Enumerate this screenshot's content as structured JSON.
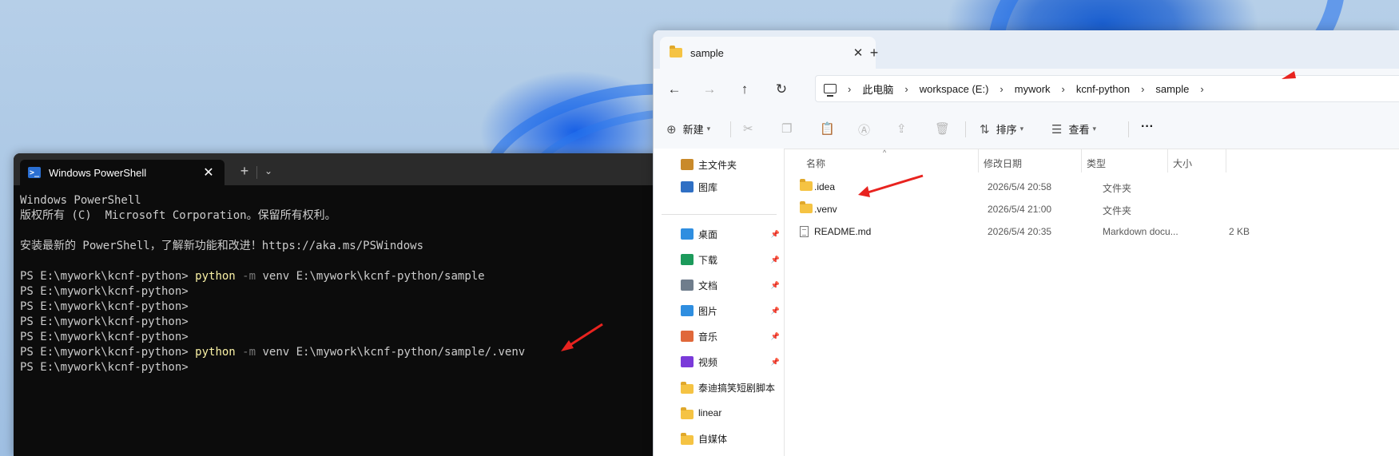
{
  "terminal": {
    "tab_title": "Windows PowerShell",
    "lines": [
      {
        "pre": "Windows PowerShell",
        "cmd": "",
        "flag": "",
        "post": ""
      },
      {
        "pre": "版权所有 (C)  Microsoft Corporation。保留所有权利。",
        "cmd": "",
        "flag": "",
        "post": ""
      },
      {
        "pre": "",
        "cmd": "",
        "flag": "",
        "post": ""
      },
      {
        "pre": "安装最新的 PowerShell，了解新功能和改进！https://aka.ms/PSWindows",
        "cmd": "",
        "flag": "",
        "post": ""
      },
      {
        "pre": "",
        "cmd": "",
        "flag": "",
        "post": ""
      },
      {
        "pre": "PS E:\\mywork\\kcnf-python> ",
        "cmd": "python",
        "flag": " -m",
        "post": " venv E:\\mywork\\kcnf-python/sample"
      },
      {
        "pre": "PS E:\\mywork\\kcnf-python>",
        "cmd": "",
        "flag": "",
        "post": ""
      },
      {
        "pre": "PS E:\\mywork\\kcnf-python>",
        "cmd": "",
        "flag": "",
        "post": ""
      },
      {
        "pre": "PS E:\\mywork\\kcnf-python>",
        "cmd": "",
        "flag": "",
        "post": ""
      },
      {
        "pre": "PS E:\\mywork\\kcnf-python>",
        "cmd": "",
        "flag": "",
        "post": ""
      },
      {
        "pre": "PS E:\\mywork\\kcnf-python> ",
        "cmd": "python",
        "flag": " -m",
        "post": " venv E:\\mywork\\kcnf-python/sample/.venv"
      },
      {
        "pre": "PS E:\\mywork\\kcnf-python>",
        "cmd": "",
        "flag": "",
        "post": ""
      }
    ]
  },
  "explorer": {
    "tab_title": "sample",
    "breadcrumb": [
      "此电脑",
      "workspace (E:)",
      "mywork",
      "kcnf-python",
      "sample"
    ],
    "toolbar": {
      "new_label": "新建",
      "sort_label": "排序",
      "view_label": "查看",
      "more_label": "···"
    },
    "sidebar": {
      "top": [
        {
          "label": "主文件夹",
          "icon": "home-icon"
        },
        {
          "label": "图库",
          "icon": "gallery-icon"
        }
      ],
      "pinned": [
        {
          "label": "桌面",
          "icon": "desktop-icon",
          "color": "#2f8ee0"
        },
        {
          "label": "下载",
          "icon": "download-icon",
          "color": "#1c9a5b"
        },
        {
          "label": "文档",
          "icon": "document-icon",
          "color": "#6f7d8c"
        },
        {
          "label": "图片",
          "icon": "picture-icon",
          "color": "#2f8ee0"
        },
        {
          "label": "音乐",
          "icon": "music-icon",
          "color": "#e0683a"
        },
        {
          "label": "视频",
          "icon": "video-icon",
          "color": "#7a3ad9"
        }
      ],
      "folders": [
        {
          "label": "泰迪搞笑短剧脚本"
        },
        {
          "label": "linear"
        },
        {
          "label": "自媒体"
        }
      ]
    },
    "columns": {
      "name": "名称",
      "date": "修改日期",
      "type": "类型",
      "size": "大小"
    },
    "files": [
      {
        "name": ".idea",
        "date": "2026/5/4 20:58",
        "type": "文件夹",
        "size": "",
        "kind": "folder"
      },
      {
        "name": ".venv",
        "date": "2026/5/4 21:00",
        "type": "文件夹",
        "size": "",
        "kind": "folder"
      },
      {
        "name": "README.md",
        "date": "2026/5/4 20:35",
        "type": "Markdown docu...",
        "size": "2 KB",
        "kind": "doc"
      }
    ]
  },
  "colors": {
    "annotation_red": "#e8231f",
    "terminal_bg": "#0c0c0c",
    "command_yellow": "#f9f1a5"
  }
}
